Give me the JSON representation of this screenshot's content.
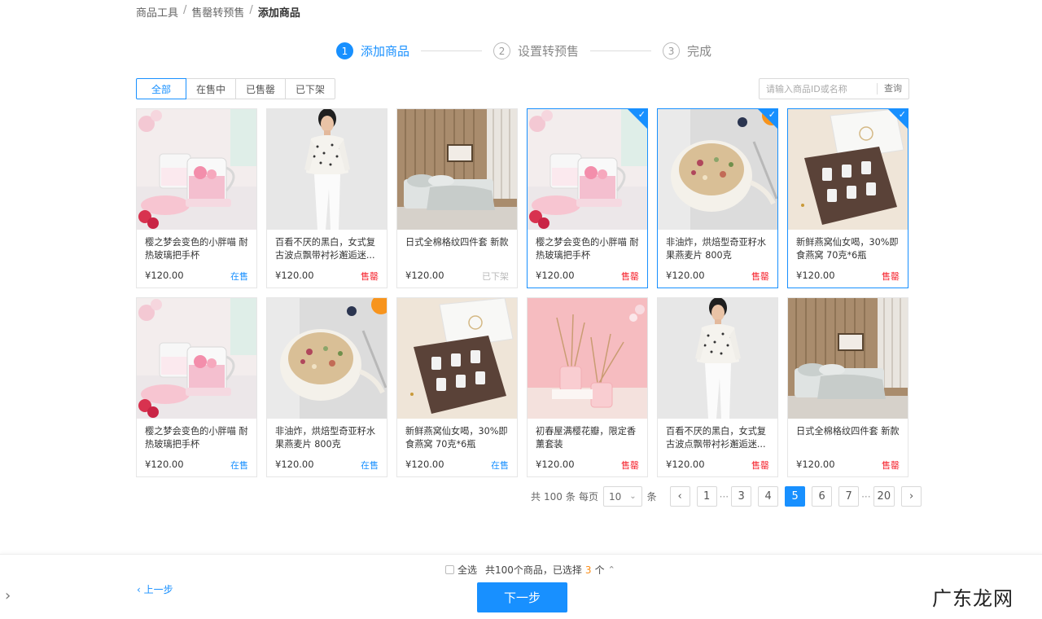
{
  "breadcrumb": {
    "items": [
      "商品工具",
      "售罄转预售"
    ],
    "current": "添加商品",
    "separator": "/"
  },
  "steps": [
    {
      "num": "1",
      "label": "添加商品",
      "active": true
    },
    {
      "num": "2",
      "label": "设置转预售",
      "active": false
    },
    {
      "num": "3",
      "label": "完成",
      "active": false
    }
  ],
  "tabs": [
    "全部",
    "在售中",
    "已售罄",
    "已下架"
  ],
  "active_tab": "全部",
  "search": {
    "placeholder": "请输入商品ID或名称",
    "button": "查询"
  },
  "products": [
    {
      "title": "樱之梦会变色的小胖喵 耐热玻璃把手杯",
      "price": "¥120.00",
      "status": "在售",
      "image": "cup",
      "selected": false
    },
    {
      "title": "百看不厌的黑白，女式复古波点飘带衬衫邂逅迷...",
      "price": "¥120.00",
      "status": "售罄",
      "image": "person",
      "selected": false
    },
    {
      "title": "日式全棉格纹四件套 新款",
      "price": "¥120.00",
      "status": "已下架",
      "image": "bed",
      "selected": false
    },
    {
      "title": "樱之梦会变色的小胖喵 耐热玻璃把手杯",
      "price": "¥120.00",
      "status": "售罄",
      "image": "cup",
      "selected": true
    },
    {
      "title": "非油炸，烘焙型奇亚籽水果燕麦片 800克",
      "price": "¥120.00",
      "status": "售罄",
      "image": "bowl",
      "selected": true
    },
    {
      "title": "新鲜燕窝仙女喝，30%即食燕窝 70克*6瓶",
      "price": "¥120.00",
      "status": "售罄",
      "image": "box",
      "selected": true
    },
    {
      "title": "樱之梦会变色的小胖喵 耐热玻璃把手杯",
      "price": "¥120.00",
      "status": "在售",
      "image": "cup",
      "selected": false
    },
    {
      "title": "非油炸，烘焙型奇亚籽水果燕麦片 800克",
      "price": "¥120.00",
      "status": "在售",
      "image": "bowl",
      "selected": false
    },
    {
      "title": "新鲜燕窝仙女喝，30%即食燕窝 70克*6瓶",
      "price": "¥120.00",
      "status": "在售",
      "image": "box",
      "selected": false
    },
    {
      "title": "初春屋满樱花瓣，限定香薰套装",
      "price": "¥120.00",
      "status": "售罄",
      "image": "diffuser",
      "selected": false
    },
    {
      "title": "百看不厌的黑白，女式复古波点飘带衬衫邂逅迷...",
      "price": "¥120.00",
      "status": "售罄",
      "image": "person",
      "selected": false
    },
    {
      "title": "日式全棉格纹四件套 新款",
      "price": "¥120.00",
      "status": "售罄",
      "image": "bed",
      "selected": false
    }
  ],
  "pagination": {
    "total_prefix": "共",
    "total": "100",
    "total_suffix": "条",
    "per_page_label": "每页",
    "page_size": "10",
    "page_size_suffix": "条",
    "pages": [
      "1",
      "3",
      "4",
      "5",
      "6",
      "7",
      "20"
    ],
    "current": "5",
    "ellipsis": "···"
  },
  "footer": {
    "select_all": "全选",
    "summary_prefix": "共100个商品，已选择",
    "selected_count": "3",
    "summary_suffix": "个",
    "prev": "上一步",
    "next": "下一步"
  },
  "watermark": "广东龙网",
  "colors": {
    "primary": "#1890ff",
    "sold_out": "#f5222d",
    "selected_count": "#fa8c16",
    "off_shelf": "#bbbbbb"
  }
}
